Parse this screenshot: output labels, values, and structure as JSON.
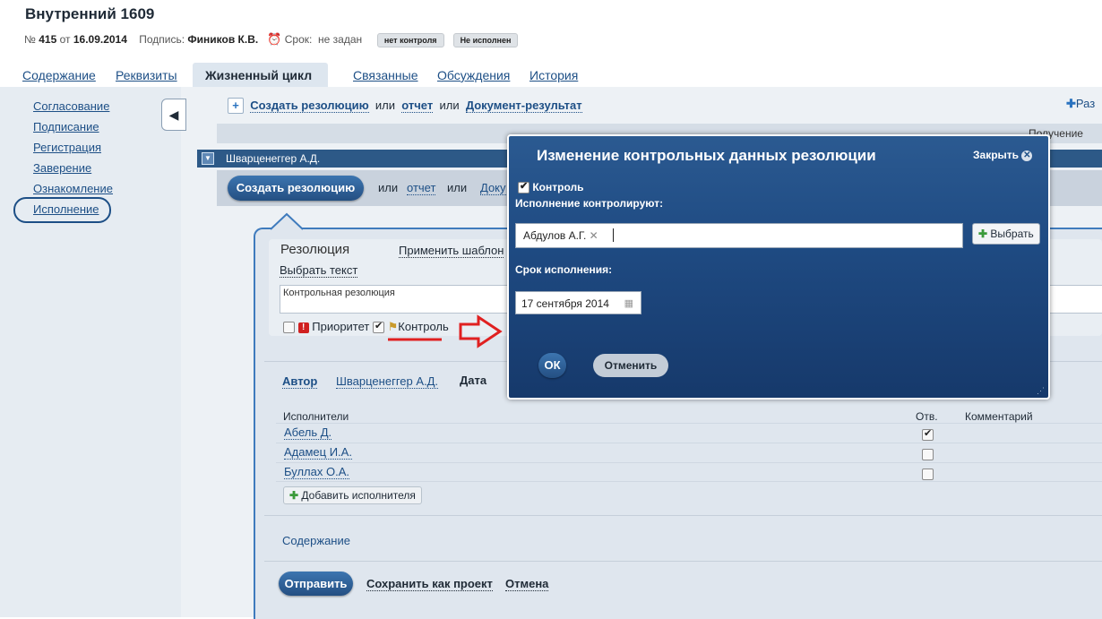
{
  "doc": {
    "title": "Внутренний 1609",
    "num_prefix": "№",
    "number": "415",
    "from_label": "от",
    "date": "16.09.2014",
    "signed_label": "Подпись:",
    "signer": "Фиников К.В.",
    "deadline_label": "Срок:",
    "deadline_value": "не задан",
    "badge1": "нет контроля",
    "badge2": "Не исполнен"
  },
  "tabs": [
    {
      "label": "Содержание"
    },
    {
      "label": "Реквизиты"
    },
    {
      "label": "Жизненный цикл",
      "active": true
    },
    {
      "label": "Связанные"
    },
    {
      "label": "Обсуждения"
    },
    {
      "label": "История"
    }
  ],
  "sidebar": {
    "items": [
      {
        "label": "Согласование"
      },
      {
        "label": "Подписание"
      },
      {
        "label": "Регистрация"
      },
      {
        "label": "Заверение"
      },
      {
        "label": "Ознакомление"
      },
      {
        "label": "Исполнение",
        "selected": true
      }
    ]
  },
  "toolbar": {
    "create_resolution": "Создать резолюцию",
    "or1": "или",
    "report": "отчет",
    "or2": "или",
    "doc_result": "Документ-результат",
    "right_link": "Раз",
    "receipt": "Получение"
  },
  "group": {
    "name": "Шварценеггер А.Д.",
    "create_btn": "Создать резолюцию",
    "or1": "или",
    "report": "отчет",
    "or2": "или",
    "doc_trunc": "Доку"
  },
  "resolution": {
    "heading": "Резолюция",
    "apply_template": "Применить шаблон",
    "choose_text": "Выбрать текст",
    "text": "Контрольная резолюция",
    "priority_label": "Приоритет",
    "control_label": "Контроль",
    "author_label": "Автор",
    "author_value": "Шварценеггер А.Д.",
    "date_label": "Дата"
  },
  "executors": {
    "header_name": "Исполнители",
    "header_resp": "Отв.",
    "header_comment": "Комментарий",
    "rows": [
      {
        "name": "Абель Д.",
        "resp": true
      },
      {
        "name": "Адамец И.А.",
        "resp": false
      },
      {
        "name": "Буллах О.А.",
        "resp": false
      }
    ],
    "add_button": "Добавить исполнителя",
    "content_link": "Содержание"
  },
  "footer": {
    "send": "Отправить",
    "save_draft": "Сохранить как проект",
    "cancel": "Отмена"
  },
  "modal": {
    "title": "Изменение контрольных данных резолюции",
    "close": "Закрыть",
    "control_label": "Контроль",
    "controllers_label": "Исполнение контролируют:",
    "controller_tag": "Абдулов А.Г.",
    "select_btn": "Выбрать",
    "due_label": "Срок исполнения:",
    "due_value": "17 сентября 2014",
    "ok": "ОК",
    "cancel": "Отменить"
  },
  "colors": {
    "accent": "#1d4f86",
    "modal_bg": "#1f4b83",
    "annotation": "#e02020"
  },
  "icons": [
    "back-arrow-icon",
    "plus-icon",
    "alarm-clock-icon",
    "exclamation-icon",
    "flag-icon",
    "calendar-icon",
    "close-circle-icon",
    "resize-grip-icon",
    "collapse-triangle-icon"
  ]
}
